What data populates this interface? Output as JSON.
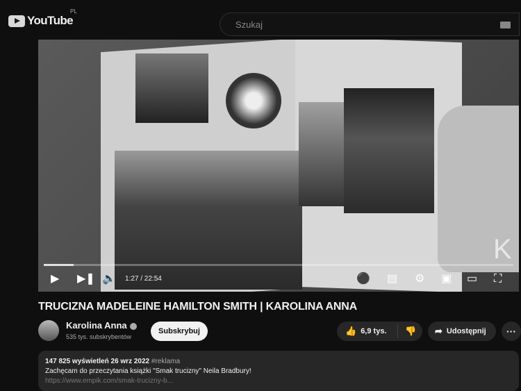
{
  "header": {
    "logo_text": "YouTube",
    "region": "PL",
    "search_placeholder": "Szukaj"
  },
  "player": {
    "time": "1:27 / 22:54",
    "progress": 0.063,
    "watermark": "K"
  },
  "video": {
    "title": "TRUCIZNA MADELEINE HAMILTON SMITH | KAROLINA ANNA"
  },
  "channel": {
    "name": "Karolina Anna",
    "subscribers": "535 tys. subskrybentów",
    "subscribe_label": "Subskrybuj"
  },
  "actions": {
    "likes": "6,9 tys.",
    "share_label": "Udostępnij",
    "more_label": "···"
  },
  "description": {
    "views_date": "147 825 wyświetleń  26 wrz 2022",
    "tag": "#reklama",
    "line1": "Zachęcam do przeczytania książki \"Smak trucizny\" Neila Bradbury!",
    "link": "https://www.empik.com/smak-trucizny-b..."
  }
}
